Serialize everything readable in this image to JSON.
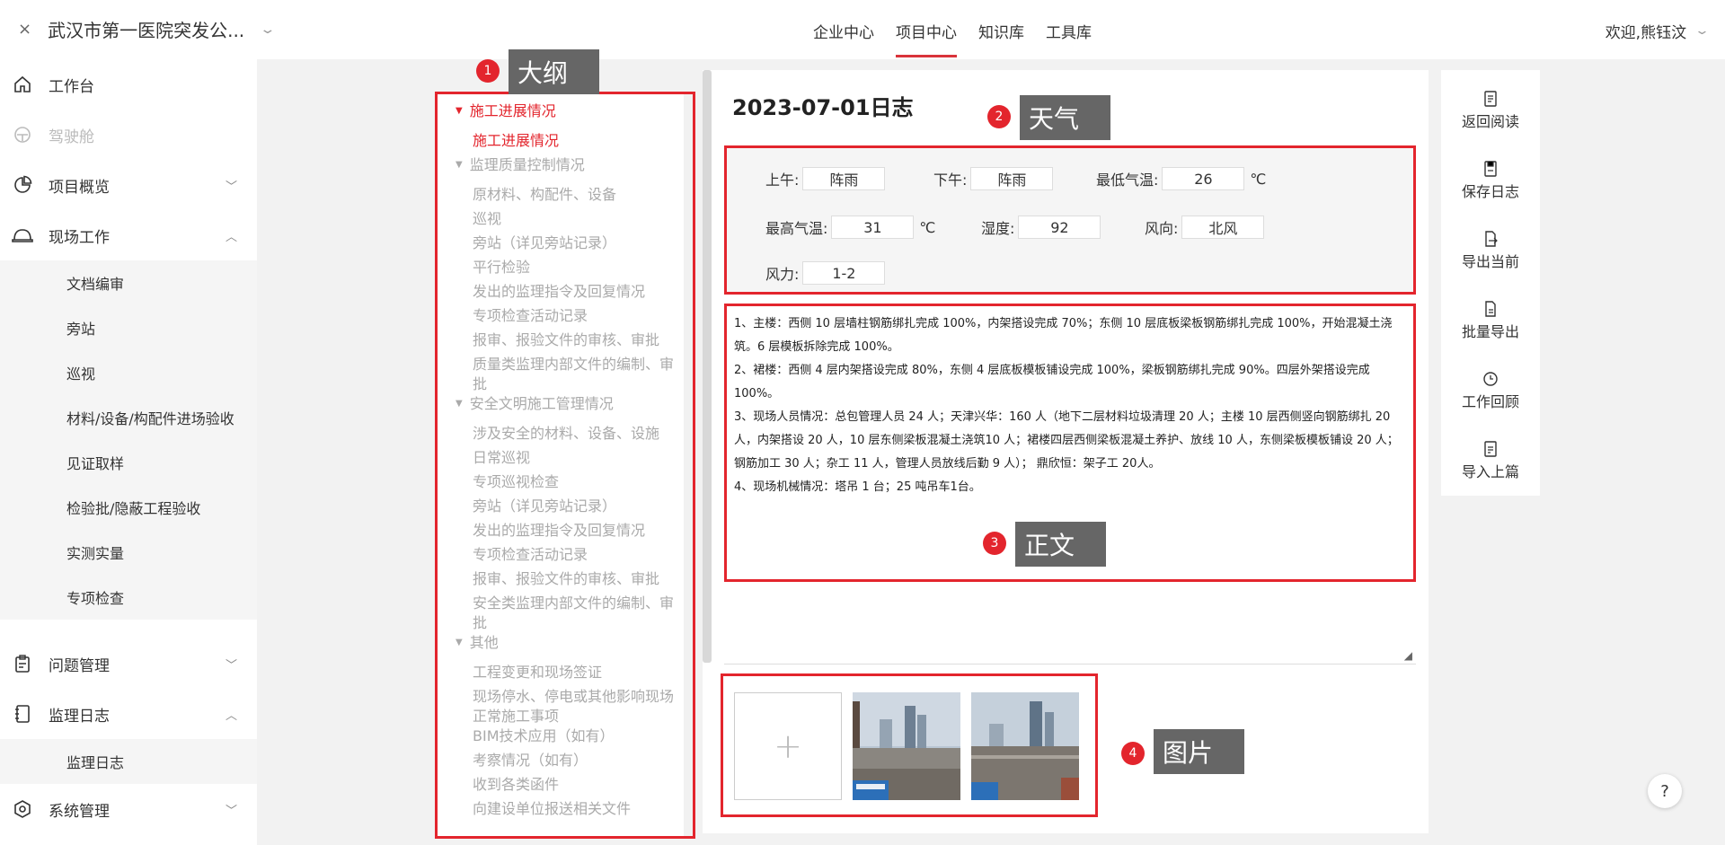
{
  "header": {
    "org_name": "武汉市第一医院突发公...",
    "close_glyph": "×",
    "nav": [
      "企业中心",
      "项目中心",
      "知识库",
      "工具库"
    ],
    "active_nav": "项目中心",
    "welcome": "欢迎,熊钰汶"
  },
  "sidebar": {
    "items": [
      {
        "label": "工作台",
        "icon": "home-icon"
      },
      {
        "label": "驾驶舱",
        "icon": "dashboard-icon"
      },
      {
        "label": "项目概览",
        "icon": "pie-chart-icon"
      },
      {
        "label": "现场工作",
        "icon": "helmet-icon"
      },
      {
        "label": "问题管理",
        "icon": "clipboard-icon"
      },
      {
        "label": "监理日志",
        "icon": "notebook-icon"
      },
      {
        "label": "系统管理",
        "icon": "settings-icon"
      }
    ],
    "field_work_sub": [
      "文档编审",
      "旁站",
      "巡视",
      "材料/设备/构配件进场验收",
      "见证取样",
      "检验批/隐蔽工程验收",
      "实测实量",
      "专项检查"
    ],
    "log_sub": [
      "监理日志"
    ]
  },
  "outline": {
    "items": [
      {
        "type": "sec",
        "text": "施工进展情况",
        "active": true
      },
      {
        "type": "sub",
        "text": "施工进展情况",
        "active": true
      },
      {
        "type": "sec",
        "text": "监理质量控制情况"
      },
      {
        "type": "sub",
        "text": "原材料、构配件、设备"
      },
      {
        "type": "sub",
        "text": "巡视"
      },
      {
        "type": "sub",
        "text": "旁站（详见旁站记录）"
      },
      {
        "type": "sub",
        "text": "平行检验"
      },
      {
        "type": "sub",
        "text": "发出的监理指令及回复情况"
      },
      {
        "type": "sub",
        "text": "专项检查活动记录"
      },
      {
        "type": "sub",
        "text": "报审、报验文件的审核、审批"
      },
      {
        "type": "sub",
        "text": "质量类监理内部文件的编制、审批"
      },
      {
        "type": "sec",
        "text": "安全文明施工管理情况"
      },
      {
        "type": "sub",
        "text": "涉及安全的材料、设备、设施"
      },
      {
        "type": "sub",
        "text": "日常巡视"
      },
      {
        "type": "sub",
        "text": "专项巡视检查"
      },
      {
        "type": "sub",
        "text": "旁站（详见旁站记录）"
      },
      {
        "type": "sub",
        "text": "发出的监理指令及回复情况"
      },
      {
        "type": "sub",
        "text": "专项检查活动记录"
      },
      {
        "type": "sub",
        "text": "报审、报验文件的审核、审批"
      },
      {
        "type": "sub",
        "text": "安全类监理内部文件的编制、审批"
      },
      {
        "type": "sec",
        "text": "其他"
      },
      {
        "type": "sub",
        "text": "工程变更和现场签证"
      },
      {
        "type": "sub",
        "text": "现场停水、停电或其他影响现场正常施工事项"
      },
      {
        "type": "sub",
        "text": "BIM技术应用（如有）"
      },
      {
        "type": "sub",
        "text": "考察情况（如有）"
      },
      {
        "type": "sub",
        "text": "收到各类函件"
      },
      {
        "type": "sub",
        "text": "向建设单位报送相关文件"
      }
    ]
  },
  "editor": {
    "title": "2023-07-01日志",
    "weather": {
      "am_label": "上午:",
      "am": "阵雨",
      "pm_label": "下午:",
      "pm": "阵雨",
      "min_label": "最低气温:",
      "min": "26",
      "max_label": "最高气温:",
      "max": "31",
      "humidity_label": "湿度:",
      "humidity": "92",
      "wind_dir_label": "风向:",
      "wind_dir": "北风",
      "wind_force_label": "风力:",
      "wind_force": "1-2",
      "unit": "℃"
    },
    "body": [
      "1、主楼：西侧 10 层墙柱钢筋绑扎完成 100%，内架搭设完成 70%；东侧 10 层底板梁板钢筋绑扎完成 100%，开始混凝土浇筑。6 层模板拆除完成 100%。",
      "2、裙楼：西侧 4 层内架搭设完成 80%，东侧 4 层底板模板铺设完成 100%，梁板钢筋绑扎完成 90%。四层外架搭设完成 100%。",
      "3、现场人员情况：总包管理人员 24 人；天津兴华：160 人（地下二层材料垃圾清理 20 人；主楼 10 层西侧竖向钢筋绑扎 20 人，内架搭设 20 人，10 层东侧梁板混凝土浇筑10 人；裙楼四层西侧梁板混凝土养护、放线 10 人，东侧梁板模板铺设 20 人；钢筋加工 30 人；杂工 11 人，管理人员放线后勤 9 人）；  鼎欣恒：架子工 20人。",
      "4、现场机械情况：塔吊 1 台；25 吨吊车1台。"
    ],
    "add_glyph": "+"
  },
  "actions": [
    {
      "label": "返回阅读",
      "icon": "document-icon"
    },
    {
      "label": "保存日志",
      "icon": "save-icon"
    },
    {
      "label": "导出当前",
      "icon": "export-icon"
    },
    {
      "label": "批量导出",
      "icon": "batch-export-icon"
    },
    {
      "label": "工作回顾",
      "icon": "history-icon"
    },
    {
      "label": "导入上篇",
      "icon": "import-icon"
    }
  ],
  "callouts": [
    {
      "num": "1",
      "label": "大纲"
    },
    {
      "num": "2",
      "label": "天气"
    },
    {
      "num": "3",
      "label": "正文"
    },
    {
      "num": "4",
      "label": "图片"
    }
  ],
  "help": "?",
  "colors": {
    "accent": "#e3252d",
    "callout_bg": "#666666",
    "sidebar_sub_bg": "#f5f5f5"
  }
}
